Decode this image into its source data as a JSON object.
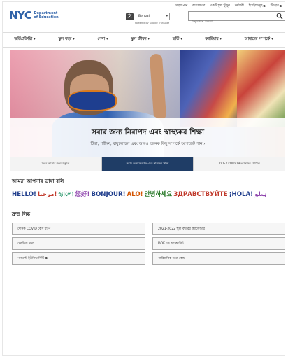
{
  "utility": {
    "items": [
      {
        "label": "সহায় পান",
        "ext": false
      },
      {
        "label": "ক্যালেন্ডার",
        "ext": false
      },
      {
        "label": "একটি স্কুল খুঁজুন",
        "ext": false
      },
      {
        "label": "কর্মচারী",
        "ext": false
      },
      {
        "label": "ইমেইলসমূহ",
        "ext": true
      },
      {
        "label": "টিচহাব",
        "ext": true
      }
    ]
  },
  "header": {
    "logo_text": "NYC",
    "logo_sub": "Department of Education",
    "translate_icon": "文",
    "language_select": "Bengali",
    "powered_by": "Powered by Google Translate",
    "search_placeholder": "অনুসন্ধান সকলে..."
  },
  "nav": {
    "items": [
      "ভর্তিপ্রক্রিয়াি ▾",
      "স্কুল বছর ▾",
      "শেখা ▾",
      "স্কুল জীবন ▾",
      "ভর্তি ▾",
      "ক্যারিয়ার ▾",
      "আমাদের সম্পর্কে ▾"
    ]
  },
  "hero": {
    "title": "সবার জন্য নিরাপদ এবং স্বাস্থ্যকর শিক্ষা",
    "subtitle": "টিকা, পরীক্ষা, বায়ুচলাচল এবং আরও অনেক কিছু সম্পর্কে আপডেট পান ›"
  },
  "tabs": [
    {
      "label": "ফিরে আসার জন্য প্রস্তুতি",
      "active": false
    },
    {
      "label": "সবার জন্য নিরাপদ এবং স্বাস্থ্যকর শিক্ষা",
      "active": true
    },
    {
      "label": "DOE COVID-19 ভ্যাকসিন পোর্টাল",
      "active": false
    }
  ],
  "languages": {
    "heading": "আমরা আপনার ভাষা বলি",
    "greetings": [
      {
        "text": "HELLO!",
        "color": "#1f3d8c"
      },
      {
        "text": "مرحبا!",
        "color": "#c0392b"
      },
      {
        "text": "হ্যালো",
        "color": "#27966a"
      },
      {
        "text": "您好!",
        "color": "#8e44ad"
      },
      {
        "text": "BONJOUR!",
        "color": "#1f3d8c"
      },
      {
        "text": "ALO!",
        "color": "#d35400"
      },
      {
        "text": "안녕하세요",
        "color": "#2a7a2a"
      },
      {
        "text": "ЗДРАВСТВУЙТЕ",
        "color": "#c0392b"
      },
      {
        "text": "¡HOLA!",
        "color": "#1f3d8c"
      },
      {
        "text": "ہیلو",
        "color": "#8e44ad"
      }
    ]
  },
  "quick_links": {
    "heading": "দ্রুত লিঙ্ক",
    "left": [
      {
        "label": "দৈনিক COVID কেস ম্যাপ",
        "ext": false
      },
      {
        "label": "কোভিড তথ্য",
        "ext": false
      },
      {
        "label": "প্যারেন্ট ইউনিভার্সিটি",
        "ext": true
      }
    ],
    "right": [
      {
        "label": "2021-2022 স্কুল বছরের ক্যালেন্ডার",
        "ext": false
      },
      {
        "label": "DOE তে অ্যাকাউন্ট",
        "ext": false
      },
      {
        "label": "পারিবারিক তথ্য কেন্দ্র",
        "ext": false
      }
    ]
  },
  "colors": {
    "brand_blue": "#2f62a8",
    "logo_star": "#f2b325",
    "active_tab": "#1f3d66"
  }
}
